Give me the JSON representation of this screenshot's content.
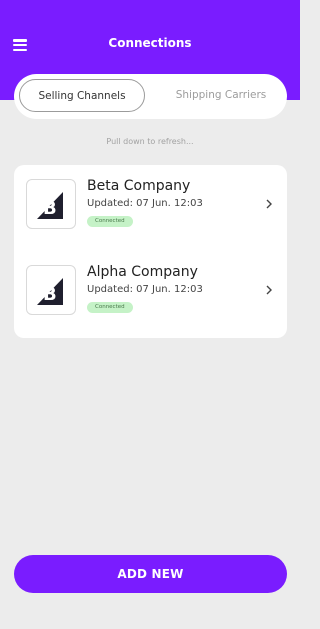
{
  "header": {
    "title": "Connections",
    "menu_icon": "hamburger-menu-icon",
    "background_color": "#7a1cff"
  },
  "tabs": [
    {
      "label": "Selling Channels",
      "selected": true
    },
    {
      "label": "Shipping Carriers",
      "selected": false
    }
  ],
  "pull_hint": "Pull down to refresh...",
  "connections": [
    {
      "name": "Beta Company",
      "updated": "Updated: 07 Jun. 12:03",
      "status": "Connected",
      "logo_icon": "bigcommerce-logo-icon"
    },
    {
      "name": "Alpha Company",
      "updated": "Updated: 07 Jun. 12:03",
      "status": "Connected",
      "logo_icon": "bigcommerce-logo-icon"
    }
  ],
  "add_button_label": "ADD NEW",
  "colors": {
    "accent": "#7a1cff",
    "status_badge": "#c5f2c7"
  }
}
